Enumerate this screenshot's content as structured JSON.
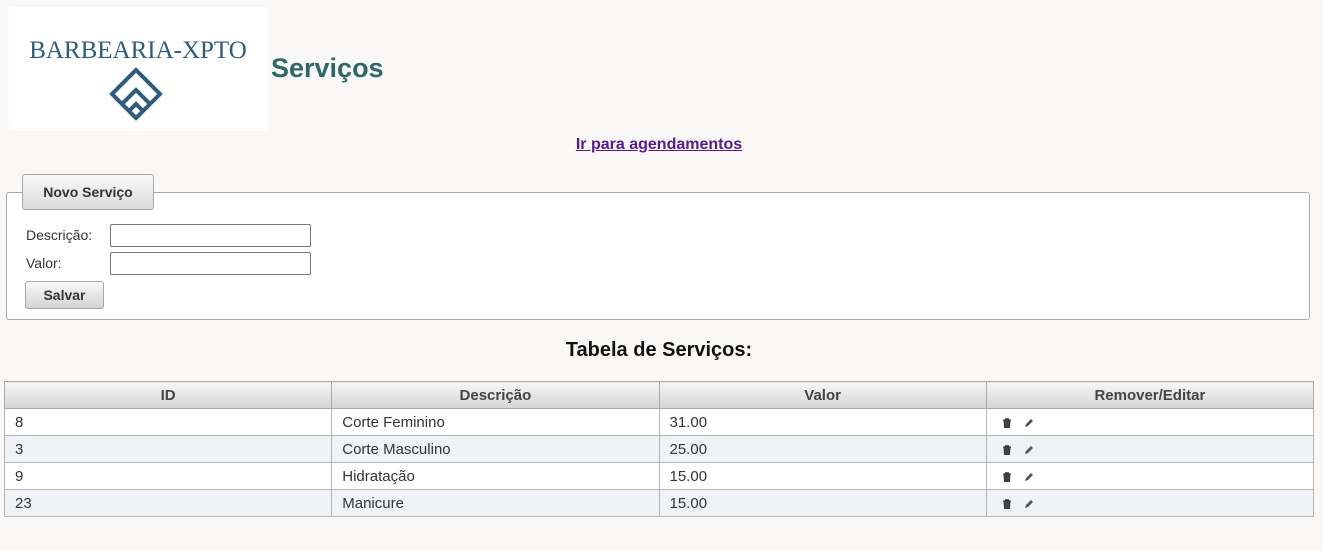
{
  "header": {
    "logo_text": "BARBEARIA-XPTO",
    "page_title": "Serviços"
  },
  "nav": {
    "link_label": "Ir para agendamentos"
  },
  "form": {
    "legend": "Novo Serviço",
    "description_label": "Descrição:",
    "description_value": "",
    "value_label": "Valor:",
    "value_value": "",
    "save_label": "Salvar"
  },
  "table": {
    "title": "Tabela de Serviços:",
    "columns": [
      "ID",
      "Descrição",
      "Valor",
      "Remover/Editar"
    ],
    "rows": [
      {
        "id": "8",
        "descricao": "Corte Feminino",
        "valor": "31.00"
      },
      {
        "id": "3",
        "descricao": "Corte Masculino",
        "valor": "25.00"
      },
      {
        "id": "9",
        "descricao": "Hidratação",
        "valor": "15.00"
      },
      {
        "id": "23",
        "descricao": "Manicure",
        "valor": "15.00"
      }
    ],
    "actions": [
      "trash-icon",
      "pencil-icon"
    ]
  },
  "colors": {
    "title": "#2e6766",
    "link": "#551a8b",
    "logo": "#2f5b7c",
    "row_alt": "#eff3f8"
  }
}
